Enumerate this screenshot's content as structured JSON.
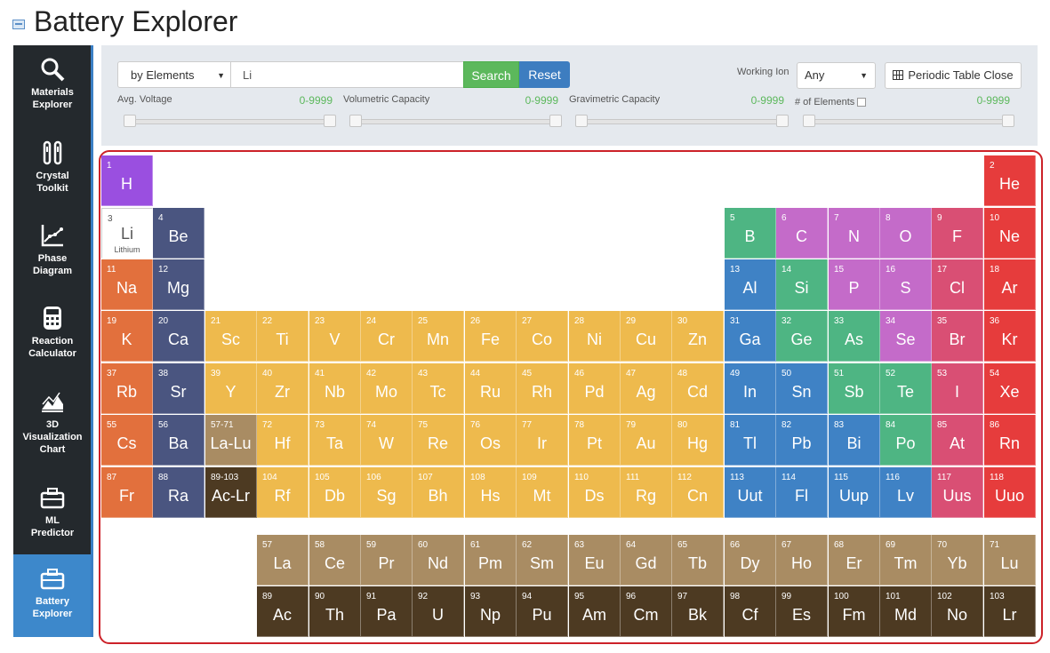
{
  "title": "Battery Explorer",
  "sidebar": [
    {
      "label1": "Materials",
      "label2": "Explorer",
      "icon": "magnifier-icon"
    },
    {
      "label1": "Crystal",
      "label2": "Toolkit",
      "icon": "tools-icon"
    },
    {
      "label1": "Phase",
      "label2": "Diagram",
      "icon": "phase-diagram-icon"
    },
    {
      "label1": "Reaction",
      "label2": "Calculator",
      "icon": "calculator-icon"
    },
    {
      "label1": "3D",
      "label2": "Visualization",
      "label3": "Chart",
      "icon": "chart-3d-icon"
    },
    {
      "label1": "ML",
      "label2": "Predictor",
      "icon": "toolbox-icon"
    },
    {
      "label1": "Battery",
      "label2": "Explorer",
      "icon": "toolbox-icon"
    }
  ],
  "search": {
    "mode": "by Elements",
    "query": "Li",
    "search_label": "Search",
    "reset_label": "Reset",
    "working_ion_label": "Working Ion",
    "working_ion_value": "Any",
    "periodic_table_button": "Periodic Table Close"
  },
  "filters": [
    {
      "label": "Avg. Voltage",
      "range": "0-9999"
    },
    {
      "label": "Volumetric Capacity",
      "range": "0-9999"
    },
    {
      "label": "Gravimetric Capacity",
      "range": "0-9999"
    },
    {
      "label": "# of Elements",
      "range": "0-9999",
      "checkbox": true
    }
  ],
  "colors": {
    "alkali": "#e2703d",
    "alkaline": "#4a5580",
    "transition": "#eeba4d",
    "post_transition": "#3f82c5",
    "metalloid": "#4eb583",
    "nonmetal": "#c46bc9",
    "halogen": "#d94f74",
    "noble": "#e63c3c",
    "hydrogen": "#9a4fe0",
    "lanthanide": "#a98c63",
    "actinide": "#4d3a22"
  },
  "selected_element": {
    "num": "3",
    "sym": "Li",
    "name": "Lithium"
  },
  "elements": [
    {
      "n": "1",
      "s": "H",
      "c": "hydrogen",
      "col": 1,
      "row": 1
    },
    {
      "n": "2",
      "s": "He",
      "c": "noble",
      "col": 18,
      "row": 1
    },
    {
      "n": "3",
      "s": "Li",
      "c": "alkali",
      "col": 1,
      "row": 2
    },
    {
      "n": "4",
      "s": "Be",
      "c": "alkaline",
      "col": 2,
      "row": 2
    },
    {
      "n": "5",
      "s": "B",
      "c": "metalloid",
      "col": 13,
      "row": 2
    },
    {
      "n": "6",
      "s": "C",
      "c": "nonmetal",
      "col": 14,
      "row": 2
    },
    {
      "n": "7",
      "s": "N",
      "c": "nonmetal",
      "col": 15,
      "row": 2
    },
    {
      "n": "8",
      "s": "O",
      "c": "nonmetal",
      "col": 16,
      "row": 2
    },
    {
      "n": "9",
      "s": "F",
      "c": "halogen",
      "col": 17,
      "row": 2
    },
    {
      "n": "10",
      "s": "Ne",
      "c": "noble",
      "col": 18,
      "row": 2
    },
    {
      "n": "11",
      "s": "Na",
      "c": "alkali",
      "col": 1,
      "row": 3
    },
    {
      "n": "12",
      "s": "Mg",
      "c": "alkaline",
      "col": 2,
      "row": 3
    },
    {
      "n": "13",
      "s": "Al",
      "c": "post_transition",
      "col": 13,
      "row": 3
    },
    {
      "n": "14",
      "s": "Si",
      "c": "metalloid",
      "col": 14,
      "row": 3
    },
    {
      "n": "15",
      "s": "P",
      "c": "nonmetal",
      "col": 15,
      "row": 3
    },
    {
      "n": "16",
      "s": "S",
      "c": "nonmetal",
      "col": 16,
      "row": 3
    },
    {
      "n": "17",
      "s": "Cl",
      "c": "halogen",
      "col": 17,
      "row": 3
    },
    {
      "n": "18",
      "s": "Ar",
      "c": "noble",
      "col": 18,
      "row": 3
    },
    {
      "n": "19",
      "s": "K",
      "c": "alkali",
      "col": 1,
      "row": 4
    },
    {
      "n": "20",
      "s": "Ca",
      "c": "alkaline",
      "col": 2,
      "row": 4
    },
    {
      "n": "21",
      "s": "Sc",
      "c": "transition",
      "col": 3,
      "row": 4
    },
    {
      "n": "22",
      "s": "Ti",
      "c": "transition",
      "col": 4,
      "row": 4
    },
    {
      "n": "23",
      "s": "V",
      "c": "transition",
      "col": 5,
      "row": 4
    },
    {
      "n": "24",
      "s": "Cr",
      "c": "transition",
      "col": 6,
      "row": 4
    },
    {
      "n": "25",
      "s": "Mn",
      "c": "transition",
      "col": 7,
      "row": 4
    },
    {
      "n": "26",
      "s": "Fe",
      "c": "transition",
      "col": 8,
      "row": 4
    },
    {
      "n": "27",
      "s": "Co",
      "c": "transition",
      "col": 9,
      "row": 4
    },
    {
      "n": "28",
      "s": "Ni",
      "c": "transition",
      "col": 10,
      "row": 4
    },
    {
      "n": "29",
      "s": "Cu",
      "c": "transition",
      "col": 11,
      "row": 4
    },
    {
      "n": "30",
      "s": "Zn",
      "c": "transition",
      "col": 12,
      "row": 4
    },
    {
      "n": "31",
      "s": "Ga",
      "c": "post_transition",
      "col": 13,
      "row": 4
    },
    {
      "n": "32",
      "s": "Ge",
      "c": "metalloid",
      "col": 14,
      "row": 4
    },
    {
      "n": "33",
      "s": "As",
      "c": "metalloid",
      "col": 15,
      "row": 4
    },
    {
      "n": "34",
      "s": "Se",
      "c": "nonmetal",
      "col": 16,
      "row": 4
    },
    {
      "n": "35",
      "s": "Br",
      "c": "halogen",
      "col": 17,
      "row": 4
    },
    {
      "n": "36",
      "s": "Kr",
      "c": "noble",
      "col": 18,
      "row": 4
    },
    {
      "n": "37",
      "s": "Rb",
      "c": "alkali",
      "col": 1,
      "row": 5
    },
    {
      "n": "38",
      "s": "Sr",
      "c": "alkaline",
      "col": 2,
      "row": 5
    },
    {
      "n": "39",
      "s": "Y",
      "c": "transition",
      "col": 3,
      "row": 5
    },
    {
      "n": "40",
      "s": "Zr",
      "c": "transition",
      "col": 4,
      "row": 5
    },
    {
      "n": "41",
      "s": "Nb",
      "c": "transition",
      "col": 5,
      "row": 5
    },
    {
      "n": "42",
      "s": "Mo",
      "c": "transition",
      "col": 6,
      "row": 5
    },
    {
      "n": "43",
      "s": "Tc",
      "c": "transition",
      "col": 7,
      "row": 5
    },
    {
      "n": "44",
      "s": "Ru",
      "c": "transition",
      "col": 8,
      "row": 5
    },
    {
      "n": "45",
      "s": "Rh",
      "c": "transition",
      "col": 9,
      "row": 5
    },
    {
      "n": "46",
      "s": "Pd",
      "c": "transition",
      "col": 10,
      "row": 5
    },
    {
      "n": "47",
      "s": "Ag",
      "c": "transition",
      "col": 11,
      "row": 5
    },
    {
      "n": "48",
      "s": "Cd",
      "c": "transition",
      "col": 12,
      "row": 5
    },
    {
      "n": "49",
      "s": "In",
      "c": "post_transition",
      "col": 13,
      "row": 5
    },
    {
      "n": "50",
      "s": "Sn",
      "c": "post_transition",
      "col": 14,
      "row": 5
    },
    {
      "n": "51",
      "s": "Sb",
      "c": "metalloid",
      "col": 15,
      "row": 5
    },
    {
      "n": "52",
      "s": "Te",
      "c": "metalloid",
      "col": 16,
      "row": 5
    },
    {
      "n": "53",
      "s": "I",
      "c": "halogen",
      "col": 17,
      "row": 5
    },
    {
      "n": "54",
      "s": "Xe",
      "c": "noble",
      "col": 18,
      "row": 5
    },
    {
      "n": "55",
      "s": "Cs",
      "c": "alkali",
      "col": 1,
      "row": 6
    },
    {
      "n": "56",
      "s": "Ba",
      "c": "alkaline",
      "col": 2,
      "row": 6
    },
    {
      "n": "57-71",
      "s": "La-Lu",
      "c": "lanthanide",
      "col": 3,
      "row": 6
    },
    {
      "n": "72",
      "s": "Hf",
      "c": "transition",
      "col": 4,
      "row": 6
    },
    {
      "n": "73",
      "s": "Ta",
      "c": "transition",
      "col": 5,
      "row": 6
    },
    {
      "n": "74",
      "s": "W",
      "c": "transition",
      "col": 6,
      "row": 6
    },
    {
      "n": "75",
      "s": "Re",
      "c": "transition",
      "col": 7,
      "row": 6
    },
    {
      "n": "76",
      "s": "Os",
      "c": "transition",
      "col": 8,
      "row": 6
    },
    {
      "n": "77",
      "s": "Ir",
      "c": "transition",
      "col": 9,
      "row": 6
    },
    {
      "n": "78",
      "s": "Pt",
      "c": "transition",
      "col": 10,
      "row": 6
    },
    {
      "n": "79",
      "s": "Au",
      "c": "transition",
      "col": 11,
      "row": 6
    },
    {
      "n": "80",
      "s": "Hg",
      "c": "transition",
      "col": 12,
      "row": 6
    },
    {
      "n": "81",
      "s": "Tl",
      "c": "post_transition",
      "col": 13,
      "row": 6
    },
    {
      "n": "82",
      "s": "Pb",
      "c": "post_transition",
      "col": 14,
      "row": 6
    },
    {
      "n": "83",
      "s": "Bi",
      "c": "post_transition",
      "col": 15,
      "row": 6
    },
    {
      "n": "84",
      "s": "Po",
      "c": "metalloid",
      "col": 16,
      "row": 6
    },
    {
      "n": "85",
      "s": "At",
      "c": "halogen",
      "col": 17,
      "row": 6
    },
    {
      "n": "86",
      "s": "Rn",
      "c": "noble",
      "col": 18,
      "row": 6
    },
    {
      "n": "87",
      "s": "Fr",
      "c": "alkali",
      "col": 1,
      "row": 7
    },
    {
      "n": "88",
      "s": "Ra",
      "c": "alkaline",
      "col": 2,
      "row": 7
    },
    {
      "n": "89-103",
      "s": "Ac-Lr",
      "c": "actinide",
      "col": 3,
      "row": 7
    },
    {
      "n": "104",
      "s": "Rf",
      "c": "transition",
      "col": 4,
      "row": 7
    },
    {
      "n": "105",
      "s": "Db",
      "c": "transition",
      "col": 5,
      "row": 7
    },
    {
      "n": "106",
      "s": "Sg",
      "c": "transition",
      "col": 6,
      "row": 7
    },
    {
      "n": "107",
      "s": "Bh",
      "c": "transition",
      "col": 7,
      "row": 7
    },
    {
      "n": "108",
      "s": "Hs",
      "c": "transition",
      "col": 8,
      "row": 7
    },
    {
      "n": "109",
      "s": "Mt",
      "c": "transition",
      "col": 9,
      "row": 7
    },
    {
      "n": "110",
      "s": "Ds",
      "c": "transition",
      "col": 10,
      "row": 7
    },
    {
      "n": "111",
      "s": "Rg",
      "c": "transition",
      "col": 11,
      "row": 7
    },
    {
      "n": "112",
      "s": "Cn",
      "c": "transition",
      "col": 12,
      "row": 7
    },
    {
      "n": "113",
      "s": "Uut",
      "c": "post_transition",
      "col": 13,
      "row": 7
    },
    {
      "n": "114",
      "s": "Fl",
      "c": "post_transition",
      "col": 14,
      "row": 7
    },
    {
      "n": "115",
      "s": "Uup",
      "c": "post_transition",
      "col": 15,
      "row": 7
    },
    {
      "n": "116",
      "s": "Lv",
      "c": "post_transition",
      "col": 16,
      "row": 7
    },
    {
      "n": "117",
      "s": "Uus",
      "c": "halogen",
      "col": 17,
      "row": 7
    },
    {
      "n": "118",
      "s": "Uuo",
      "c": "noble",
      "col": 18,
      "row": 7
    },
    {
      "n": "57",
      "s": "La",
      "c": "lanthanide",
      "col": 4,
      "row": 8
    },
    {
      "n": "58",
      "s": "Ce",
      "c": "lanthanide",
      "col": 5,
      "row": 8
    },
    {
      "n": "59",
      "s": "Pr",
      "c": "lanthanide",
      "col": 6,
      "row": 8
    },
    {
      "n": "60",
      "s": "Nd",
      "c": "lanthanide",
      "col": 7,
      "row": 8
    },
    {
      "n": "61",
      "s": "Pm",
      "c": "lanthanide",
      "col": 8,
      "row": 8
    },
    {
      "n": "62",
      "s": "Sm",
      "c": "lanthanide",
      "col": 9,
      "row": 8
    },
    {
      "n": "63",
      "s": "Eu",
      "c": "lanthanide",
      "col": 10,
      "row": 8
    },
    {
      "n": "64",
      "s": "Gd",
      "c": "lanthanide",
      "col": 11,
      "row": 8
    },
    {
      "n": "65",
      "s": "Tb",
      "c": "lanthanide",
      "col": 12,
      "row": 8
    },
    {
      "n": "66",
      "s": "Dy",
      "c": "lanthanide",
      "col": 13,
      "row": 8
    },
    {
      "n": "67",
      "s": "Ho",
      "c": "lanthanide",
      "col": 14,
      "row": 8
    },
    {
      "n": "68",
      "s": "Er",
      "c": "lanthanide",
      "col": 15,
      "row": 8
    },
    {
      "n": "69",
      "s": "Tm",
      "c": "lanthanide",
      "col": 16,
      "row": 8
    },
    {
      "n": "70",
      "s": "Yb",
      "c": "lanthanide",
      "col": 17,
      "row": 8
    },
    {
      "n": "71",
      "s": "Lu",
      "c": "lanthanide",
      "col": 18,
      "row": 8
    },
    {
      "n": "89",
      "s": "Ac",
      "c": "actinide",
      "col": 4,
      "row": 9
    },
    {
      "n": "90",
      "s": "Th",
      "c": "actinide",
      "col": 5,
      "row": 9
    },
    {
      "n": "91",
      "s": "Pa",
      "c": "actinide",
      "col": 6,
      "row": 9
    },
    {
      "n": "92",
      "s": "U",
      "c": "actinide",
      "col": 7,
      "row": 9
    },
    {
      "n": "93",
      "s": "Np",
      "c": "actinide",
      "col": 8,
      "row": 9
    },
    {
      "n": "94",
      "s": "Pu",
      "c": "actinide",
      "col": 9,
      "row": 9
    },
    {
      "n": "95",
      "s": "Am",
      "c": "actinide",
      "col": 10,
      "row": 9
    },
    {
      "n": "96",
      "s": "Cm",
      "c": "actinide",
      "col": 11,
      "row": 9
    },
    {
      "n": "97",
      "s": "Bk",
      "c": "actinide",
      "col": 12,
      "row": 9
    },
    {
      "n": "98",
      "s": "Cf",
      "c": "actinide",
      "col": 13,
      "row": 9
    },
    {
      "n": "99",
      "s": "Es",
      "c": "actinide",
      "col": 14,
      "row": 9
    },
    {
      "n": "100",
      "s": "Fm",
      "c": "actinide",
      "col": 15,
      "row": 9
    },
    {
      "n": "101",
      "s": "Md",
      "c": "actinide",
      "col": 16,
      "row": 9
    },
    {
      "n": "102",
      "s": "No",
      "c": "actinide",
      "col": 17,
      "row": 9
    },
    {
      "n": "103",
      "s": "Lr",
      "c": "actinide",
      "col": 18,
      "row": 9
    }
  ]
}
